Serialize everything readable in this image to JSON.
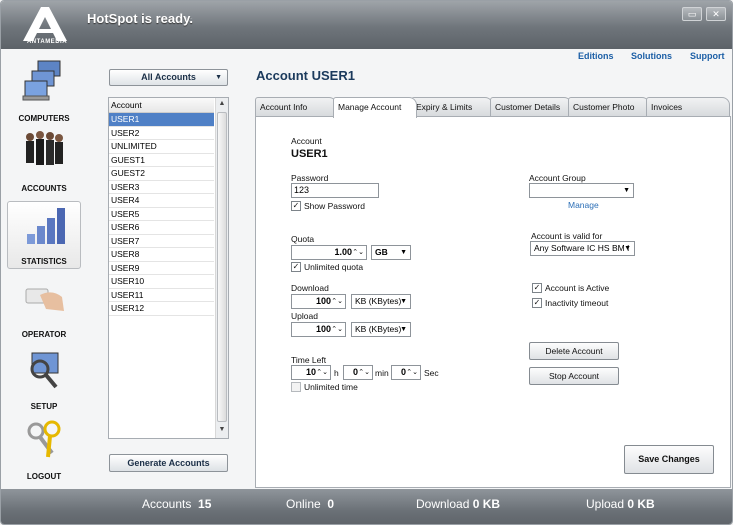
{
  "app": {
    "title": "HotSpot is ready.",
    "logo_text": "ANTAMEDIA",
    "window_buttons": [
      "▭",
      "✕"
    ]
  },
  "sidebar": {
    "items": [
      {
        "label": "COMPUTERS",
        "icon": "computers-icon"
      },
      {
        "label": "ACCOUNTS",
        "icon": "accounts-icon"
      },
      {
        "label": "STATISTICS",
        "icon": "statistics-icon"
      },
      {
        "label": "OPERATOR",
        "icon": "operator-icon"
      },
      {
        "label": "SETUP",
        "icon": "setup-icon"
      },
      {
        "label": "LOGOUT",
        "icon": "logout-icon"
      }
    ],
    "active": "STATISTICS"
  },
  "top_links": [
    "Editions",
    "Solutions",
    "Support"
  ],
  "accounts_panel": {
    "filter_selected": "All Accounts",
    "list_header": "Account",
    "items": [
      "USER1",
      "USER2",
      "UNLIMITED",
      "GUEST1",
      "GUEST2",
      "USER3",
      "USER4",
      "USER5",
      "USER6",
      "USER7",
      "USER8",
      "USER9",
      "USER10",
      "USER11",
      "USER12"
    ],
    "selected": "USER1",
    "generate_label": "Generate Accounts"
  },
  "detail": {
    "title": "Account  USER1",
    "tabs": [
      "Account Info",
      "Manage Account",
      "Expiry & Limits",
      "Customer Details",
      "Customer Photo",
      "Invoices"
    ],
    "active_tab": "Manage Account",
    "account_label": "Account",
    "account_value": "USER1",
    "password_label": "Password",
    "password_value": "123",
    "show_password_label": "Show Password",
    "show_password_checked": true,
    "quota_label": "Quota",
    "quota_value": "1.00",
    "quota_unit": "GB",
    "unlimited_quota_label": "Unlimited quota",
    "unlimited_quota_checked": true,
    "download_label": "Download",
    "download_value": "100",
    "download_unit": "KB (KBytes)",
    "upload_label": "Upload",
    "upload_value": "100",
    "upload_unit": "KB (KBytes)",
    "time_left_label": "Time Left",
    "hours_value": "10",
    "hours_unit": "h",
    "minutes_value": "0",
    "minutes_unit": "min",
    "seconds_value": "0",
    "seconds_unit": "Sec",
    "unlimited_time_label": "Unlimited time",
    "unlimited_time_checked": false,
    "account_group_label": "Account Group",
    "account_group_value": "",
    "manage_link": "Manage",
    "valid_for_label": "Account is valid for",
    "valid_for_value": "Any Software IC HS BM I",
    "active_label": "Account is Active",
    "active_checked": true,
    "inactivity_label": "Inactivity timeout",
    "inactivity_checked": true,
    "delete_label": "Delete Account",
    "stop_label": "Stop Account",
    "save_label": "Save Changes"
  },
  "status": {
    "accounts_label": "Accounts",
    "accounts_value": "15",
    "online_label": "Online",
    "online_value": "0",
    "download_label": "Download",
    "download_value": "0 KB",
    "upload_label": "Upload",
    "upload_value": "0 KB"
  },
  "colors": {
    "accent": "#1c5fa6",
    "selection": "#4f80c6"
  }
}
